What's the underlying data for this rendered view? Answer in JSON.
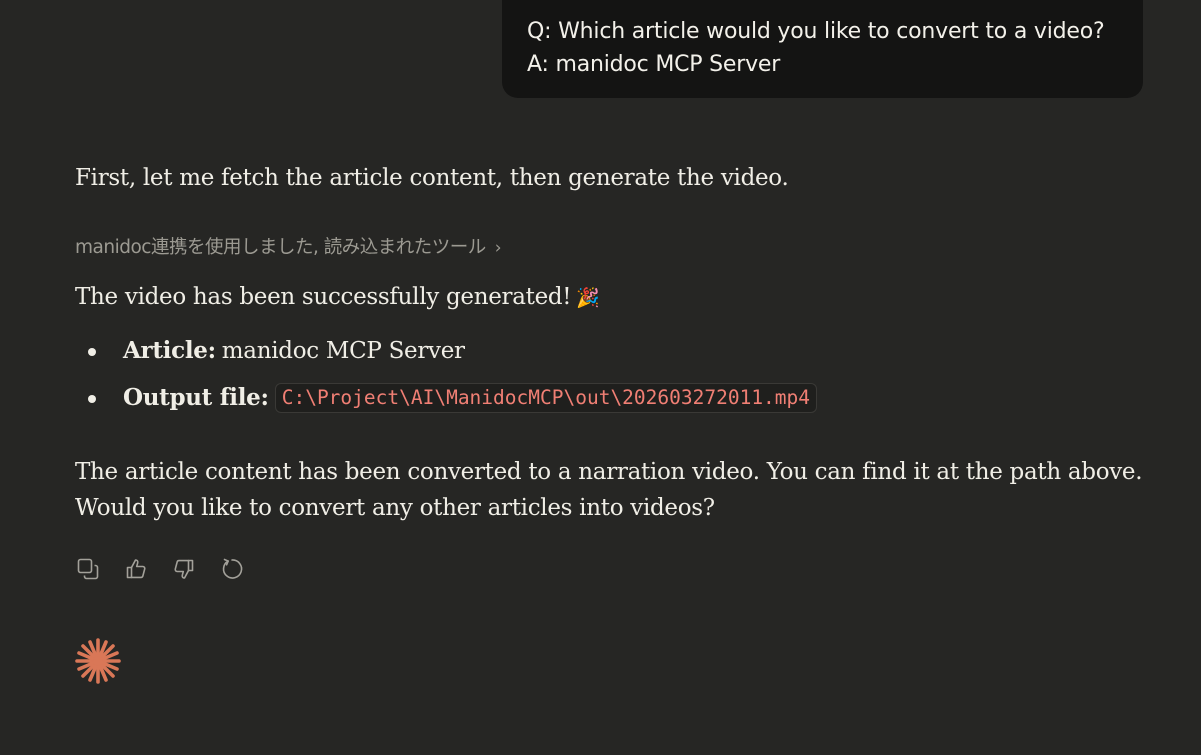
{
  "user_message": {
    "lines": [
      "Q: Which article would you like to convert to a video?",
      "A: manidoc MCP Server"
    ]
  },
  "assistant": {
    "intro": "First, let me fetch the article content, then generate the video.",
    "tool_use": {
      "label": "manidoc連携を使用しました, 読み込まれたツール",
      "chevron": "›"
    },
    "success": "The video has been successfully generated!",
    "success_emoji": "🎉",
    "bullets": [
      {
        "label": "Article:",
        "value": "manidoc MCP Server"
      },
      {
        "label": "Output file:",
        "code": "C:\\Project\\AI\\ManidocMCP\\out\\202603272011.mp4"
      }
    ],
    "outro_lines": [
      "The article content has been converted to a narration video. You can find it at the path above.",
      "Would you like to convert any other articles into videos?"
    ]
  },
  "actions": [
    {
      "name": "copy",
      "icon": "copy-icon"
    },
    {
      "name": "thumbs-up",
      "icon": "thumbs-up-icon"
    },
    {
      "name": "thumbs-down",
      "icon": "thumbs-down-icon"
    },
    {
      "name": "retry",
      "icon": "retry-icon"
    }
  ],
  "colors": {
    "background": "#262624",
    "bubble": "#141413",
    "text": "#f0eee6",
    "muted": "#9c9a92",
    "code_text": "#f07f74",
    "accent_spark": "#d97757"
  }
}
